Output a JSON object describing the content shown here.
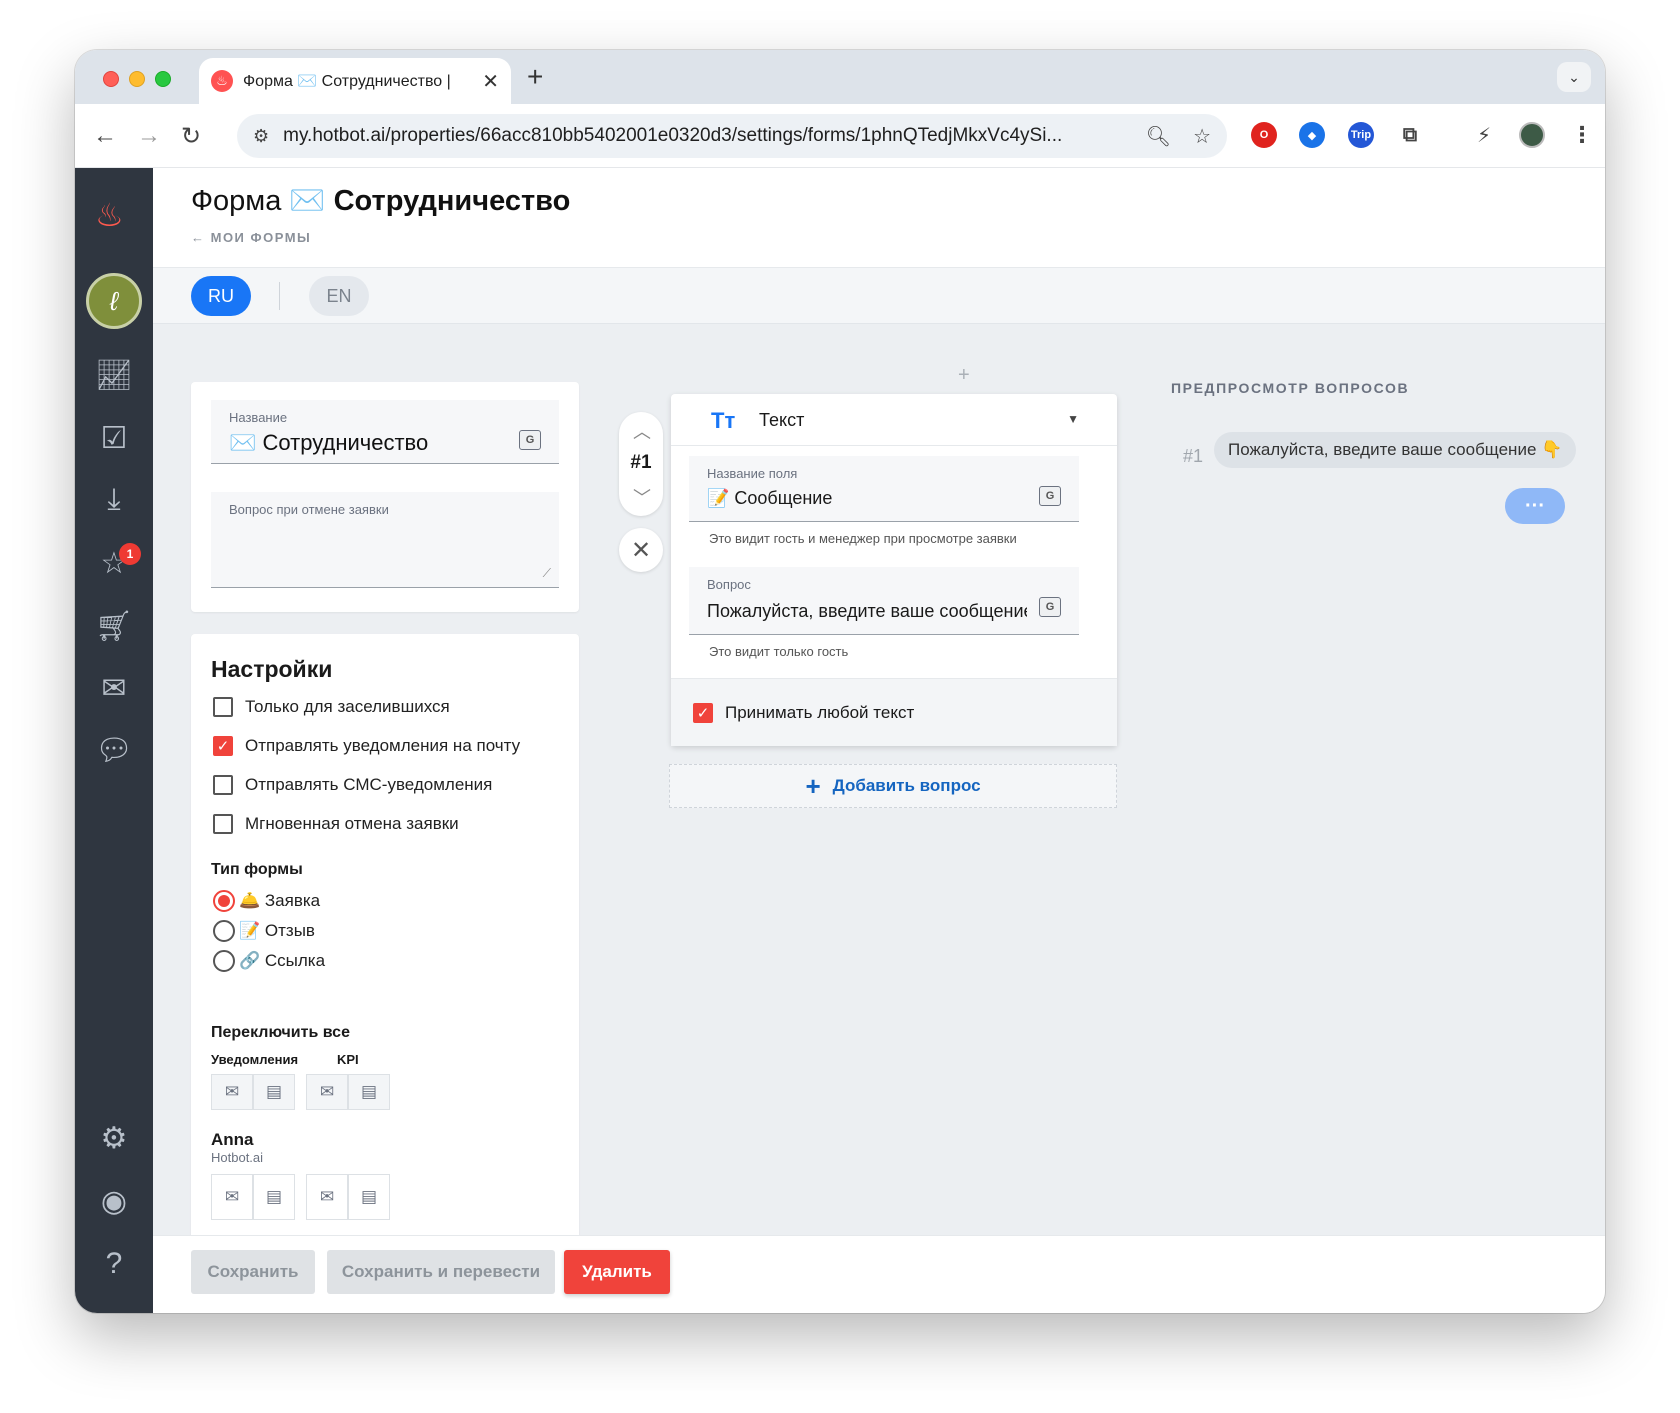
{
  "browser": {
    "tab_title": "Форма ✉️ Сотрудничество |",
    "url": "my.hotbot.ai/properties/66acc810bb5402001e0320d3/settings/forms/1phnQTedjMkxVc4ySi...",
    "new_tab": "+",
    "close_tab": "✕"
  },
  "sidebar": {
    "badge": "1"
  },
  "header": {
    "title_prefix": "Форма ✉️",
    "title_name": "Сотрудничество",
    "breadcrumb": "← МОИ ФОРМЫ"
  },
  "languages": {
    "ru": "RU",
    "en": "EN"
  },
  "form_card": {
    "name_label": "Название",
    "name_value": "✉️ Сотрудничество",
    "cancel_question_label": "Вопрос при отмене заявки",
    "cancel_question_value": ""
  },
  "settings": {
    "title": "Настройки",
    "options": [
      {
        "label": "Только для заселившихся",
        "checked": false
      },
      {
        "label": "Отправлять уведомления на почту",
        "checked": true
      },
      {
        "label": "Отправлять СМС-уведомления",
        "checked": false
      },
      {
        "label": "Мгновенная отмена заявки",
        "checked": false
      }
    ],
    "form_type_title": "Тип формы",
    "form_types": [
      {
        "label": "🛎️ Заявка",
        "selected": true
      },
      {
        "label": "📝 Отзыв",
        "selected": false
      },
      {
        "label": "🔗 Ссылка",
        "selected": false
      }
    ],
    "toggle_all": "Переключить все",
    "col_notifications": "Уведомления",
    "col_kpi": "KPI",
    "user_name": "Anna",
    "user_org": "Hotbot.ai"
  },
  "question": {
    "number": "#1",
    "type_label": "Текст",
    "type_icon": "Tт",
    "field_name_label": "Название поля",
    "field_name_value": "📝 Сообщение",
    "field_name_hint": "Это видит гость и менеджер при просмотре заявки",
    "question_label": "Вопрос",
    "question_value": "Пожалуйста, введите ваше сообщение 👇",
    "question_hint": "Это видит только гость",
    "accept_any_text": "Принимать любой текст",
    "accept_any_checked": true,
    "add_question": "Добавить вопрос",
    "plus": "+"
  },
  "preview": {
    "title": "ПРЕДПРОСМОТР ВОПРОСОВ",
    "number": "#1",
    "bubble": "Пожалуйста, введите ваше сообщение 👇",
    "more": "···"
  },
  "footer": {
    "save": "Сохранить",
    "save_translate": "Сохранить и перевести",
    "delete": "Удалить"
  },
  "colors": {
    "accent": "#1976f6",
    "danger": "#f0433b",
    "sidebar_bg": "#2f3640",
    "main_bg": "#eceff2"
  }
}
